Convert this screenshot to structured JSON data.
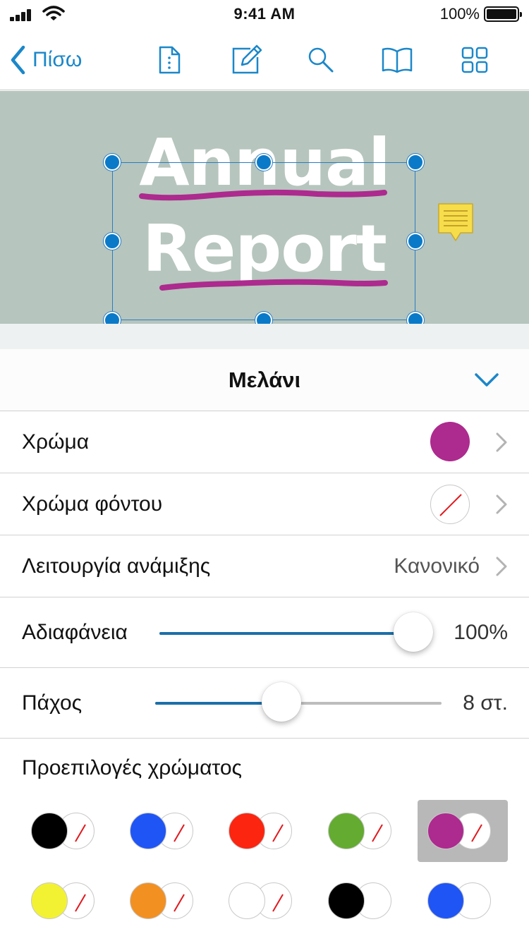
{
  "status_bar": {
    "time": "9:41 AM",
    "battery": "100%"
  },
  "nav": {
    "back_label": "Πίσω",
    "icons": [
      "document-icon",
      "edit-icon",
      "search-icon",
      "book-icon",
      "grid-icon"
    ]
  },
  "document": {
    "line1": "Annual",
    "line2": "Report",
    "ink_color": "#ad2a8e"
  },
  "panel": {
    "title": "Μελάνι"
  },
  "rows": {
    "color": {
      "label": "Χρώμα",
      "value_color": "#ad2a8e"
    },
    "background_color": {
      "label": "Χρώμα φόντου",
      "value": "none"
    },
    "blend_mode": {
      "label": "Λειτουργία ανάμιξης",
      "value": "Κανονικό"
    },
    "opacity": {
      "label": "Αδιαφάνεια",
      "value": "100%",
      "level": 1.0
    },
    "thickness": {
      "label": "Πάχος",
      "value": "8 στ.",
      "level": 0.44
    }
  },
  "presets": {
    "title": "Προεπιλογές χρώματος",
    "items": [
      {
        "fg": "#000000",
        "bg": "none",
        "selected": false
      },
      {
        "fg": "#1f55f5",
        "bg": "none",
        "selected": false
      },
      {
        "fg": "#fb2510",
        "bg": "none",
        "selected": false
      },
      {
        "fg": "#64ab31",
        "bg": "none",
        "selected": false
      },
      {
        "fg": "#ad2a8e",
        "bg": "none",
        "selected": true
      },
      {
        "fg": "#f2f232",
        "bg": "none",
        "selected": false
      },
      {
        "fg": "#f29022",
        "bg": "none",
        "selected": false
      },
      {
        "fg": "#ffffff",
        "bg": "none",
        "selected": false
      },
      {
        "fg": "#000000",
        "bg": "#ffffff",
        "selected": false
      },
      {
        "fg": "#1f55f5",
        "bg": "#ffffff",
        "selected": false
      }
    ]
  },
  "colors": {
    "accent": "#1b87c9",
    "selection": "#0a7ac8",
    "doc_background": "#b6c5bd"
  }
}
